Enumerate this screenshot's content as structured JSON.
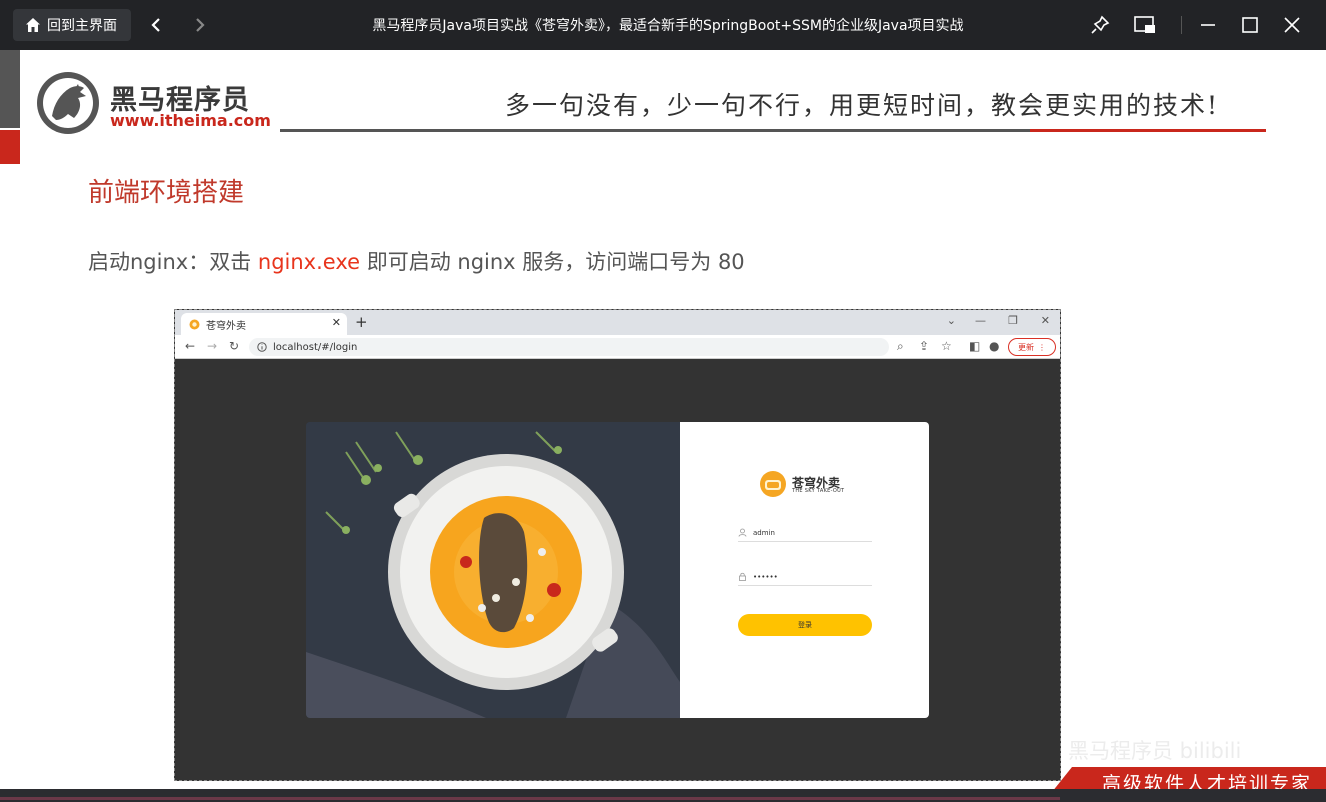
{
  "titlebar": {
    "home_label": "回到主界面",
    "title": "黑马程序员Java项目实战《苍穹外卖》，最适合新手的SpringBoot+SSM的企业级Java项目实战"
  },
  "slide": {
    "logo_cn": "黑马程序员",
    "logo_en": "www.itheima.com",
    "slogan": "多一句没有，少一句不行，用更短时间，教会更实用的技术!",
    "heading": "前端环境搭建",
    "body": {
      "part1": "启动nginx：双击 ",
      "highlight": "nginx.exe",
      "part2": " 即可启动 nginx 服务，访问端口号为 80"
    }
  },
  "browser": {
    "tab_title": "苍穹外卖",
    "url": "localhost/#/login",
    "update_label": "更新",
    "login": {
      "brand_cn": "苍穹外卖",
      "brand_en": "THE SKY TAKE-OUT",
      "username": "admin",
      "password": "••••••",
      "button": "登录"
    }
  },
  "footer": {
    "watermark": "黑马程序员 bilibili",
    "banner": "高级软件人才培训专家"
  },
  "colors": {
    "accent_red": "#c9271c",
    "highlight_red": "#e8341c",
    "login_yellow": "#ffc200"
  }
}
